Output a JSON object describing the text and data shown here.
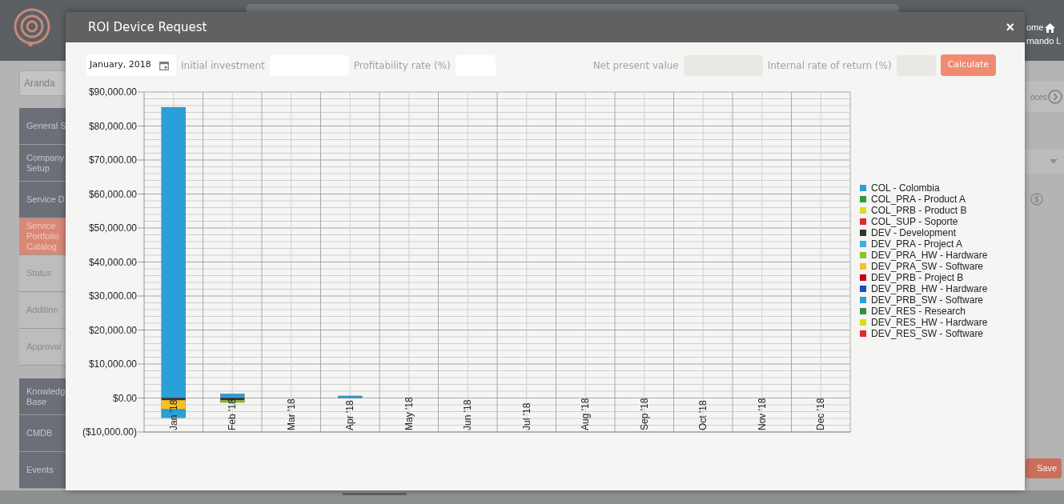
{
  "background": {
    "header_links": [
      "ome",
      "rnando L"
    ],
    "search_value": "Aranda",
    "sidebar": [
      {
        "label": "General S",
        "kind": "section",
        "selected": false
      },
      {
        "label": "Company\nSetup",
        "kind": "section",
        "selected": false
      },
      {
        "label": "Service D",
        "kind": "section",
        "selected": false
      },
      {
        "label": "Service\nPortfolio\nCatalog",
        "kind": "section",
        "selected": true
      },
      {
        "label": "Status",
        "kind": "sub",
        "selected": false
      },
      {
        "label": "Addition",
        "kind": "sub",
        "selected": false
      },
      {
        "label": "Approval",
        "kind": "sub",
        "selected": false
      },
      {
        "label": "Knowledg\nBase",
        "kind": "section",
        "selected": false
      },
      {
        "label": "CMDB",
        "kind": "section",
        "selected": false
      },
      {
        "label": "Events",
        "kind": "section",
        "selected": false
      }
    ],
    "tab_text": "oces",
    "save_button": "Save"
  },
  "dialog": {
    "title": "ROI Device Request",
    "close": "×",
    "date": "January, 2018",
    "inputs": [
      {
        "label": "Initial investment",
        "disabled": false
      },
      {
        "label": "Profitability rate (%)",
        "disabled": false
      }
    ],
    "results": [
      {
        "label": "Net present value",
        "disabled": true
      },
      {
        "label": "Internal rate of return (%)",
        "disabled": true
      }
    ],
    "calculate": "Calculate",
    "chart_data": {
      "type": "bar",
      "stacked": true,
      "grid": true,
      "legend": true,
      "categories": [
        "Jan '18",
        "Feb '18",
        "Mar '18",
        "Apr '18",
        "May '18",
        "Jun '18",
        "Jul '18",
        "Aug '18",
        "Sep '18",
        "Oct '18",
        "Nov '18",
        "Dec '18"
      ],
      "ylim": [
        -10000,
        90000
      ],
      "yticks": [
        {
          "value": -10000,
          "label": "($10,000.00)"
        },
        {
          "value": 0,
          "label": "$0.00"
        },
        {
          "value": 10000,
          "label": "$10,000.00"
        },
        {
          "value": 20000,
          "label": "$20,000.00"
        },
        {
          "value": 30000,
          "label": "$30,000.00"
        },
        {
          "value": 40000,
          "label": "$40,000.00"
        },
        {
          "value": 50000,
          "label": "$50,000.00"
        },
        {
          "value": 60000,
          "label": "$60,000.00"
        },
        {
          "value": 70000,
          "label": "$70,000.00"
        },
        {
          "value": 80000,
          "label": "$80,000.00"
        },
        {
          "value": 90000,
          "label": "$90,000.00"
        }
      ],
      "series": [
        {
          "name": "COL - Colombia",
          "color": "#2a9fd8",
          "values": [
            85500,
            1200,
            0,
            600,
            0,
            0,
            0,
            0,
            0,
            0,
            0,
            0
          ]
        },
        {
          "name": "COL_PRA - Product A",
          "color": "#2c9c3e",
          "values": [
            0,
            0,
            0,
            0,
            0,
            0,
            0,
            0,
            0,
            0,
            0,
            0
          ]
        },
        {
          "name": "COL_PRB - Product B",
          "color": "#d4e021",
          "values": [
            0,
            0,
            0,
            0,
            0,
            0,
            0,
            0,
            0,
            0,
            0,
            0
          ]
        },
        {
          "name": "COL_SUP - Soporte",
          "color": "#e02a2a",
          "values": [
            0,
            0,
            0,
            0,
            0,
            0,
            0,
            0,
            0,
            0,
            0,
            0
          ]
        },
        {
          "name": "DEV - Development",
          "color": "#333333",
          "values": [
            -600,
            -600,
            0,
            0,
            0,
            0,
            0,
            0,
            0,
            0,
            0,
            0
          ]
        },
        {
          "name": "DEV_PRA - Project A",
          "color": "#3caee8",
          "values": [
            0,
            0,
            0,
            0,
            0,
            0,
            0,
            0,
            0,
            0,
            0,
            0
          ]
        },
        {
          "name": "DEV_PRA_HW - Hardware",
          "color": "#8ec326",
          "values": [
            0,
            -700,
            0,
            0,
            0,
            0,
            0,
            0,
            0,
            0,
            0,
            0
          ]
        },
        {
          "name": "DEV_PRA_SW - Software",
          "color": "#f7c124",
          "values": [
            -2800,
            0,
            0,
            0,
            0,
            0,
            0,
            0,
            0,
            0,
            0,
            0
          ]
        },
        {
          "name": "DEV_PRB - Project B",
          "color": "#c0001c",
          "values": [
            0,
            0,
            0,
            0,
            0,
            0,
            0,
            0,
            0,
            0,
            0,
            0
          ]
        },
        {
          "name": "DEV_PRB_HW - Hardware",
          "color": "#1a4fb8",
          "values": [
            0,
            0,
            0,
            0,
            0,
            0,
            0,
            0,
            0,
            0,
            0,
            0
          ]
        },
        {
          "name": "DEV_PRB_SW - Software",
          "color": "#28a0d8",
          "values": [
            -2400,
            0,
            0,
            0,
            0,
            0,
            0,
            0,
            0,
            0,
            0,
            0
          ]
        },
        {
          "name": "DEV_RES - Research",
          "color": "#2f8f3f",
          "values": [
            0,
            0,
            0,
            0,
            0,
            0,
            0,
            0,
            0,
            0,
            0,
            0
          ]
        },
        {
          "name": "DEV_RES_HW - Hardware",
          "color": "#d4e012",
          "values": [
            0,
            0,
            0,
            0,
            0,
            0,
            0,
            0,
            0,
            0,
            0,
            0
          ]
        },
        {
          "name": "DEV_RES_SW - Software",
          "color": "#e02a2a",
          "values": [
            0,
            0,
            0,
            0,
            0,
            0,
            0,
            0,
            0,
            0,
            0,
            0
          ]
        }
      ]
    }
  }
}
